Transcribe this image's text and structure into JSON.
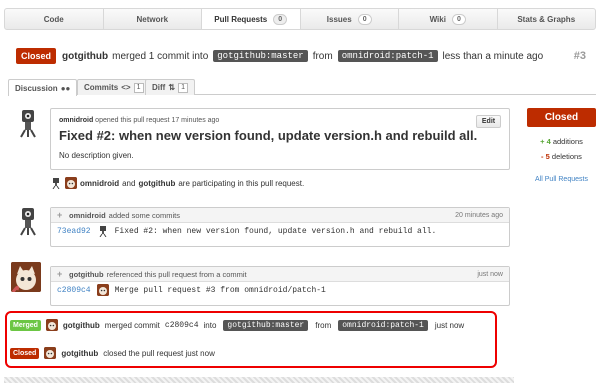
{
  "nav": {
    "tabs": [
      {
        "label": "Code",
        "count": ""
      },
      {
        "label": "Network",
        "count": ""
      },
      {
        "label": "Pull Requests",
        "count": "0"
      },
      {
        "label": "Issues",
        "count": "0"
      },
      {
        "label": "Wiki",
        "count": "0"
      },
      {
        "label": "Stats & Graphs",
        "count": ""
      }
    ]
  },
  "header": {
    "status": "Closed",
    "user": "gotgithub",
    "text1": "merged 1 commit into",
    "base_ref": "gotgithub:master",
    "text2": "from",
    "head_ref": "omnidroid:patch-1",
    "text3": "less than a minute ago",
    "number": "#3"
  },
  "subtabs": {
    "discussion": "Discussion",
    "commits": "Commits",
    "commits_count": "1",
    "diff": "Diff",
    "diff_count": "1"
  },
  "comment": {
    "author": "omnidroid",
    "meta": "opened this pull request 17 minutes ago",
    "title": "Fixed #2: when new version found, update version.h and rebuild all.",
    "body": "No description given.",
    "edit_label": "Edit"
  },
  "participants": {
    "user1": "omnidroid",
    "and": "and",
    "user2": "gotgithub",
    "text": "are participating in this pull request."
  },
  "event_commits": {
    "author": "omnidroid",
    "text": "added some commits",
    "time": "20 minutes ago",
    "sha": "73ead92",
    "message": "Fixed #2: when new version found, update version.h and rebuild all."
  },
  "event_reference": {
    "author": "gotgithub",
    "text": "referenced this pull request from a commit",
    "time": "just now",
    "sha": "c2809c4",
    "message": "Merge pull request #3 from omnidroid/patch-1"
  },
  "event_merged": {
    "badge": "Merged",
    "user": "gotgithub",
    "text1": "merged commit",
    "sha": "c2809c4",
    "text2": "into",
    "base_ref": "gotgithub:master",
    "text3": "from",
    "head_ref": "omnidroid:patch-1",
    "time": "just now"
  },
  "event_closed": {
    "badge": "Closed",
    "user": "gotgithub",
    "text": "closed the pull request just now"
  },
  "sidebar": {
    "state": "Closed",
    "additions_num": "+ 4",
    "additions_label": "additions",
    "deletions_num": "- 5",
    "deletions_label": "deletions",
    "all_link": "All Pull Requests"
  },
  "colors": {
    "closed": "#bd2c00",
    "merged": "#6cc644",
    "link": "#4183c4",
    "highlight": "#ee0000"
  }
}
